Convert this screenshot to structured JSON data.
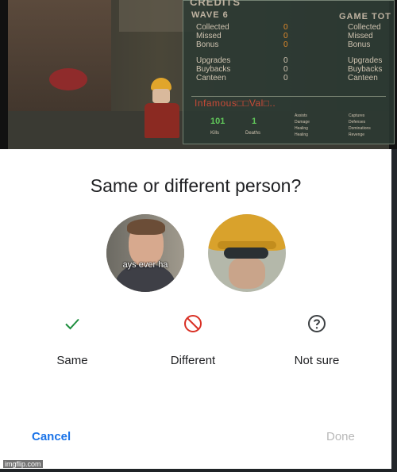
{
  "game": {
    "panel_title": "CREDITS",
    "wave_label": "WAVE 6",
    "total_label": "GAME TOT",
    "wave_rows": [
      "Collected",
      "Missed",
      "Bonus"
    ],
    "wave_values": [
      "0",
      "0",
      "0"
    ],
    "total_rows": [
      "Collected",
      "Missed",
      "Bonus"
    ],
    "wave_rows2": [
      "Upgrades",
      "Buybacks",
      "Canteen"
    ],
    "wave_values2": [
      "0",
      "0",
      "0"
    ],
    "total_rows2": [
      "Upgrades",
      "Buybacks",
      "Canteen"
    ],
    "player_name": "Infamous□□Val□..",
    "kills_value": "101",
    "kills_label": "Kills",
    "deaths_value": "1",
    "deaths_label": "Deaths",
    "stats_col1": [
      "Assists",
      "Damage",
      "Healing",
      "Healing"
    ],
    "stats_col2": [
      "Captures",
      "Defenses",
      "Dominations",
      "Revenge"
    ]
  },
  "dialog": {
    "title": "Same or different person?",
    "avatar1_caption": "ays ever ha",
    "options": [
      {
        "label": "Same",
        "icon": "check-icon",
        "color": "#1e8e3e"
      },
      {
        "label": "Different",
        "icon": "block-icon",
        "color": "#d93025"
      },
      {
        "label": "Not sure",
        "icon": "help-circle-icon",
        "color": "#3c4043"
      }
    ],
    "cancel_label": "Cancel",
    "done_label": "Done",
    "accent_color": "#1a73e8"
  },
  "watermark": "imgflip.com"
}
